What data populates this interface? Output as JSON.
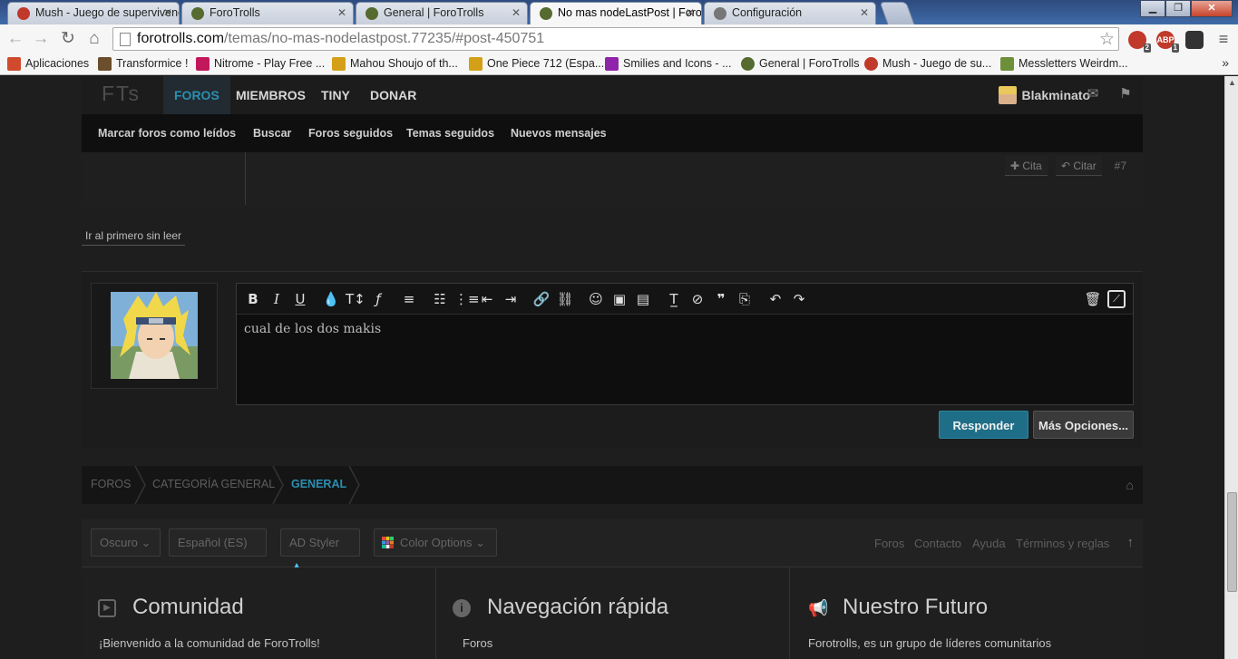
{
  "browser": {
    "tabs": [
      {
        "title": "Mush - Juego de supervivencia",
        "favicon_color": "#c0392b"
      },
      {
        "title": "ForoTrolls",
        "favicon_color": "#556b2f"
      },
      {
        "title": "General | ForoTrolls",
        "favicon_color": "#556b2f"
      },
      {
        "title": "No mas nodeLastPost | ForoTrolls",
        "favicon_color": "#556b2f"
      },
      {
        "title": "Configuración",
        "favicon_color": "#777777"
      }
    ],
    "url_host": "forotrolls.com",
    "url_path": "/temas/no-mas-nodelastpost.77235/#post-450751",
    "extensions": [
      {
        "label": "",
        "badge": "2",
        "color": "#c0392b"
      },
      {
        "label": "ABP",
        "badge": "1",
        "color": "#c0392b"
      },
      {
        "label": "",
        "badge": "",
        "color": "#333333"
      }
    ],
    "bookmarks": [
      {
        "label": "Aplicaciones",
        "color": "#d24a2d"
      },
      {
        "label": "Transformice !",
        "color": "#6b4e2b"
      },
      {
        "label": "Nitrome - Play Free ...",
        "color": "#c2185b"
      },
      {
        "label": "Mahou Shoujo of th...",
        "color": "#d4a017"
      },
      {
        "label": "One Piece 712 (Espa...",
        "color": "#d4a017"
      },
      {
        "label": "Smilies and Icons - ...",
        "color": "#8e24aa"
      },
      {
        "label": "General | ForoTrolls",
        "color": "#556b2f"
      },
      {
        "label": "Mush - Juego de su...",
        "color": "#c0392b"
      },
      {
        "label": "Messletters Weirdm...",
        "color": "#6d8f3a"
      }
    ],
    "bookmarks_more": "»"
  },
  "site": {
    "logo": "FTs",
    "nav": [
      "FOROS",
      "MIEMBROS",
      "TINY",
      "DONAR"
    ],
    "active_nav": "FOROS",
    "username": "Blakminato",
    "subnav": [
      "Marcar foros como leídos",
      "Buscar",
      "Foros seguidos",
      "Temas seguidos",
      "Nuevos mensajes"
    ],
    "accent": "#2b8fb0"
  },
  "post": {
    "cita_label": "Cita",
    "citar_label": "Citar",
    "number": "#7"
  },
  "unread_link": "Ir al primero sin leer",
  "reply": {
    "text": "cual de los dos makis",
    "submit_label": "Responder",
    "more_label": "Más Opciones..."
  },
  "breadcrumb": [
    "FOROS",
    "CATEGORÍA GENERAL",
    "GENERAL"
  ],
  "footer": {
    "dropdowns": [
      "Oscuro",
      "Español (ES)",
      "AD Styler",
      "Color Options"
    ],
    "links": [
      "Foros",
      "Contacto",
      "Ayuda",
      "Términos y reglas"
    ],
    "columns": [
      {
        "title": "Comunidad",
        "text": "¡Bienvenido a la comunidad de ForoTrolls!"
      },
      {
        "title": "Navegación rápida",
        "text": "Foros"
      },
      {
        "title": "Nuestro Futuro",
        "text": "Forotrolls, es un grupo de líderes comunitarios"
      }
    ]
  }
}
